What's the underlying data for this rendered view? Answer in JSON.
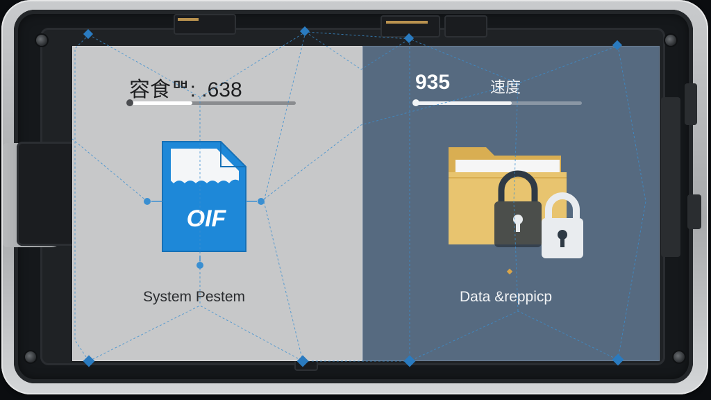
{
  "left_panel": {
    "metric_value": "容食ᄜ: .638",
    "progress": 0.38,
    "icon_name": "file-icon",
    "icon_text": "OIF",
    "caption": "System Pestem",
    "colors": {
      "background": "#c7c8c9",
      "icon": "#1e88d8",
      "bar": "#4b4d50"
    }
  },
  "right_panel": {
    "metric_value": "935",
    "metric_label": "速度",
    "progress": 0.58,
    "icon_name": "folder-lock-icon",
    "caption": "Data &reppicp",
    "colors": {
      "background": "#566a80",
      "folder": "#e8c46f",
      "lock": "#e9ecef",
      "bar": "#f2f4f6"
    }
  }
}
